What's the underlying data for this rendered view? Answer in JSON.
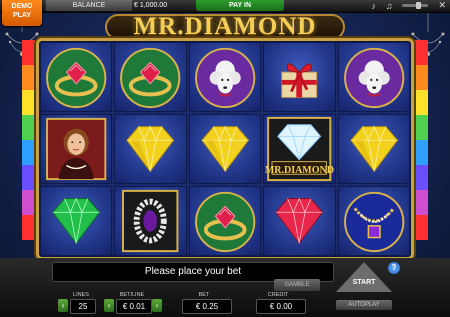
{
  "topbar": {
    "demo_line1": "DEMO",
    "demo_line2": "PLAY",
    "balance_label": "BALANCE",
    "balance_value": "€ 1,000.00",
    "payin_label": "PAY IN",
    "icons": [
      "music-icon",
      "volume-slider",
      "fullscreen-icon"
    ]
  },
  "logo": {
    "text": "MR.DIAMOND"
  },
  "reels": [
    [
      "ring-ruby",
      "ring-ruby",
      "poodle",
      "gift-box",
      "poodle"
    ],
    [
      "lady-portrait",
      "diamond-yellow",
      "diamond-yellow",
      "mr-diamond-wild",
      "diamond-yellow"
    ],
    [
      "diamond-green",
      "ring-oval",
      "ring-ruby",
      "diamond-red",
      "necklace"
    ]
  ],
  "wild_label": "MR.DIAMOND",
  "message": "Please place your bet",
  "buttons": {
    "gamble": "GAMBLE",
    "start": "START",
    "autoplay": "AUTOPLAY",
    "help": "?"
  },
  "controls": {
    "lines_label": "LINES",
    "lines_value": "25",
    "betline_label": "BET/LINE",
    "betline_value": "€ 0.01",
    "bet_label": "BET",
    "bet_value": "€ 0.25",
    "credit_label": "CREDIT",
    "credit_value": "€ 0.00"
  },
  "colors": {
    "gold": "#c9a042",
    "demo_orange": "#ff8a1e",
    "payin_green": "#2f9d2f"
  }
}
